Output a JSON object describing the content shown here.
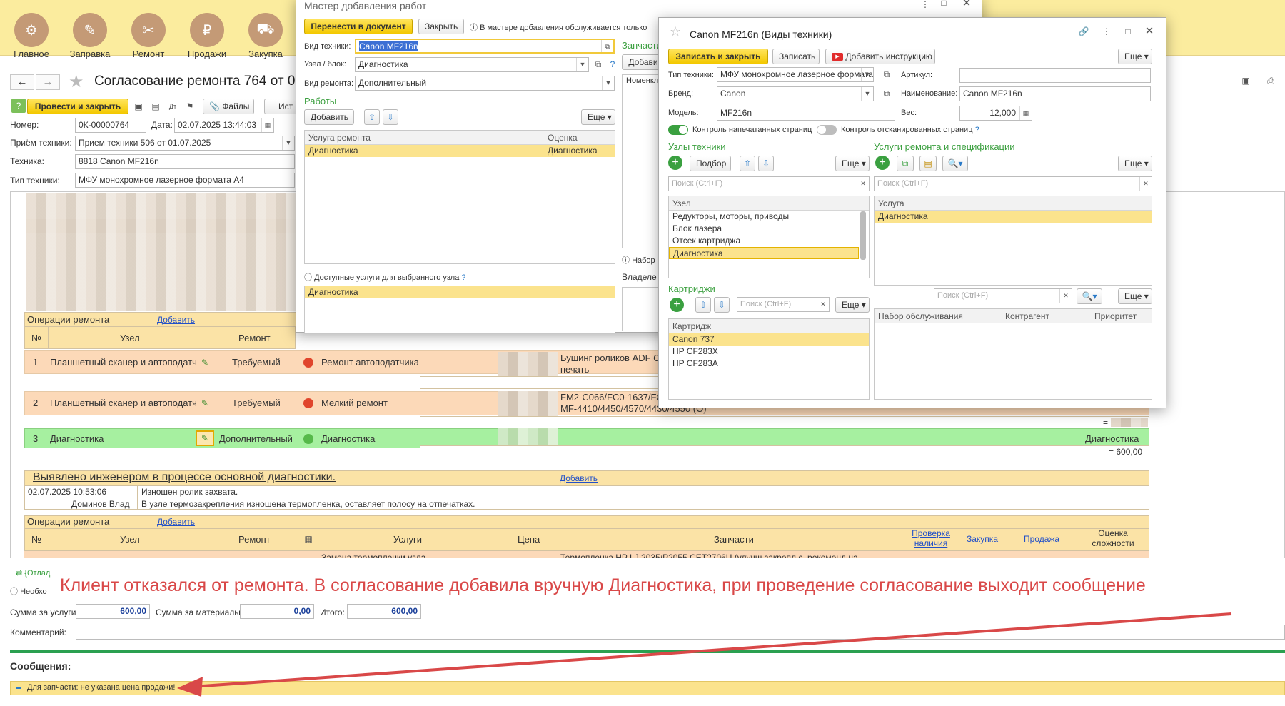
{
  "sections": [
    {
      "label": "Главное",
      "icon": "gears-icon",
      "glyph": "⚙"
    },
    {
      "label": "Заправка",
      "icon": "refill-icon",
      "glyph": "✎"
    },
    {
      "label": "Ремонт",
      "icon": "tools-icon",
      "glyph": "✂"
    },
    {
      "label": "Продажи",
      "icon": "sale-icon",
      "glyph": "₽"
    },
    {
      "label": "Закупка",
      "icon": "cart-icon",
      "glyph": "⛟"
    }
  ],
  "doc": {
    "title": "Согласование ремонта 764 от 0",
    "post_close": "Провести и закрыть",
    "files": "Файлы",
    "more_partial": "Ист",
    "number_label": "Номер:",
    "number": "0К-00000764",
    "date_label": "Дата:",
    "date": "02.07.2025 13:44:03",
    "intake_label": "Приём техники:",
    "intake": "Прием техники 506 от 01.07.2025",
    "equipment_label": "Техника:",
    "equipment": "8818 Canon  MF216n",
    "type_label": "Тип техники:",
    "type": "МФУ монохромное лазерное формата А4"
  },
  "ops": {
    "header": "Операции ремонта",
    "add": "Добавить",
    "cols": [
      "№",
      "Узел",
      "Ремонт"
    ],
    "rows": [
      {
        "n": "1",
        "node": "Планшетный сканер и автоподатчи",
        "repair": "Требуемый",
        "service": "Ремонт автоподатчика",
        "parts": "Бушинг роликов ADF C",
        "parts2": "печать"
      },
      {
        "n": "2",
        "node": "Планшетный сканер и автоподатчи",
        "repair": "Требуемый",
        "service": "Мелкий ремонт",
        "parts": "FM2-C066/FC0-1637/FC",
        "parts2": "MF-4410/4450/4570/4430/4550 (О)"
      },
      {
        "n": "3",
        "node": "Диагностика",
        "repair": "Дополнительный",
        "service": "Диагностика",
        "rating": "Диагностика",
        "sum": "= 600,00"
      }
    ],
    "row2_sum": "="
  },
  "found": {
    "title": "Выявлено инженером в процессе основной диагностики.",
    "add": "Добавить",
    "date": "02.07.2025 10:53:06",
    "author": "Доминов Влад",
    "line1": "Изношен ролик захвата.",
    "line2": "В узле термозакрепления изношена термопленка, оставляет полосу на отпечатках."
  },
  "ops2": {
    "header": "Операции ремонта",
    "add": "Добавить",
    "cols": [
      "№",
      "Узел",
      "Ремонт",
      "Услуги",
      "Цена",
      "Запчасти",
      "Проверка наличия",
      "Закупка",
      "Продажа",
      "Оценка сложности"
    ],
    "partial_service": "Замена термопленки узла",
    "partial_parts": "Термопленка HP LJ 2035/P2055 CET2706U (улучш.закрепл.с. рекоменд.на"
  },
  "bottom": {
    "debug": "{Отлад",
    "info": "Необхо",
    "services_label": "Сумма за услуги:",
    "services": "600,00",
    "materials_label": "Сумма за материалы:",
    "materials": "0,00",
    "total_label": "Итого:",
    "total": "600,00",
    "comment_label": "Комментарий:",
    "messages": "Сообщения:",
    "message": "Для запчасти:  не указана цена продажи!"
  },
  "annotation": "Клиент отказался от ремонта. В согласование добавила вручную Диагностика, при проведение согласование выходит сообщение",
  "wizard": {
    "title": "Мастер добавления работ",
    "transfer": "Перенести в документ",
    "close": "Закрыть",
    "hint": "В мастере добавления обслуживается только о",
    "type_label": "Вид техники:",
    "type": "Canon  MF216n",
    "node_label": "Узел / блок:",
    "node": "Диагностика",
    "repair_label": "Вид ремонта:",
    "repair": "Дополнительный",
    "works": "Работы",
    "add": "Добавить",
    "more": "Еще",
    "col_service": "Услуга ремонта",
    "col_rating": "Оценка",
    "row_service": "Диагностика",
    "row_rating": "Диагностика",
    "available": "Доступные услуги для выбранного узла",
    "available_row": "Диагностика",
    "parts": "Запчасти",
    "add2": "Добави",
    "nomen": "Номенкл",
    "set": "Набор",
    "owner": "Владеле"
  },
  "card": {
    "title": "Canon  MF216n (Виды техники)",
    "save_close": "Записать и закрыть",
    "save": "Записать",
    "add_instr": "Добавить инструкцию",
    "more": "Еще",
    "type_label": "Тип техники:",
    "type": "МФУ монохромное лазерное формата",
    "brand_label": "Бренд:",
    "brand": "Canon",
    "model_label": "Модель:",
    "model": "MF216n",
    "article_label": "Артикул:",
    "article": "",
    "name_label": "Наименование:",
    "name": "Canon  MF216n",
    "weight_label": "Вес:",
    "weight": "12,000",
    "printed": "Контроль напечатанных страниц",
    "scanned": "Контроль отсканированных страниц",
    "nodes": "Узлы техники",
    "pick": "Подбор",
    "search": "Поиск (Ctrl+F)",
    "col_node": "Узел",
    "node_rows": [
      "Редукторы, моторы, приводы",
      "Блок лазера",
      "Отсек картриджа",
      "Диагностика"
    ],
    "services": "Услуги ремонта и спецификации",
    "col_service": "Услуга",
    "service_rows": [
      "Диагностика"
    ],
    "col_set": "Набор обслуживания",
    "col_contractor": "Контрагент",
    "col_priority": "Приоритет",
    "cartridges": "Картриджи",
    "col_cartridge": "Картридж",
    "cartridge_rows": [
      "Canon 737",
      "HP CF283X",
      "HP CF283A"
    ]
  }
}
